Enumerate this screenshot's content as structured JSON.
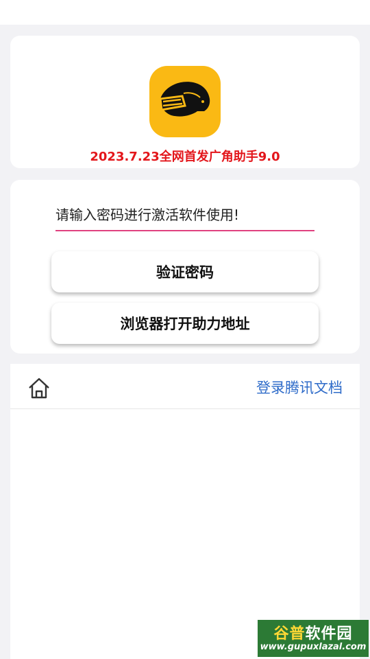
{
  "header": {
    "app_icon": "helmet-icon",
    "title": "2023.7.23全网首发广角助手9.0",
    "title_color": "#e3161b",
    "icon_bg_color": "#fab914"
  },
  "form": {
    "password_placeholder": "请输入密码进行激活软件使用!",
    "verify_button": "验证密码",
    "browser_button": "浏览器打开助力地址",
    "accent_color": "#e0417f"
  },
  "webview": {
    "home_icon": "home-icon",
    "login_link": "登录腾讯文档",
    "link_color": "#2e6bc9"
  },
  "watermark": {
    "brand_part1": "谷普",
    "brand_part2": "软件园",
    "url": "www.gupuxlazal.com"
  }
}
